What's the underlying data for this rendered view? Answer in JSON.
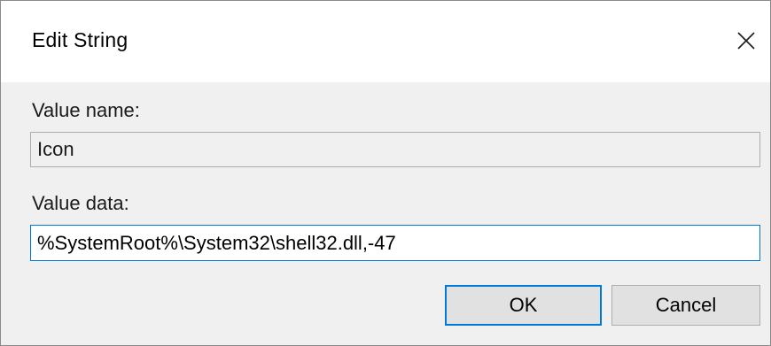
{
  "dialog": {
    "title": "Edit String",
    "close_icon": "close-icon"
  },
  "value_name": {
    "label": "Value name:",
    "value": "Icon"
  },
  "value_data": {
    "label": "Value data:",
    "value": "%SystemRoot%\\System32\\shell32.dll,-47"
  },
  "buttons": {
    "ok_label": "OK",
    "cancel_label": "Cancel"
  },
  "colors": {
    "accent": "#0078d7",
    "dialog_bg": "#f0f0f0",
    "button_bg": "#e1e1e1"
  }
}
